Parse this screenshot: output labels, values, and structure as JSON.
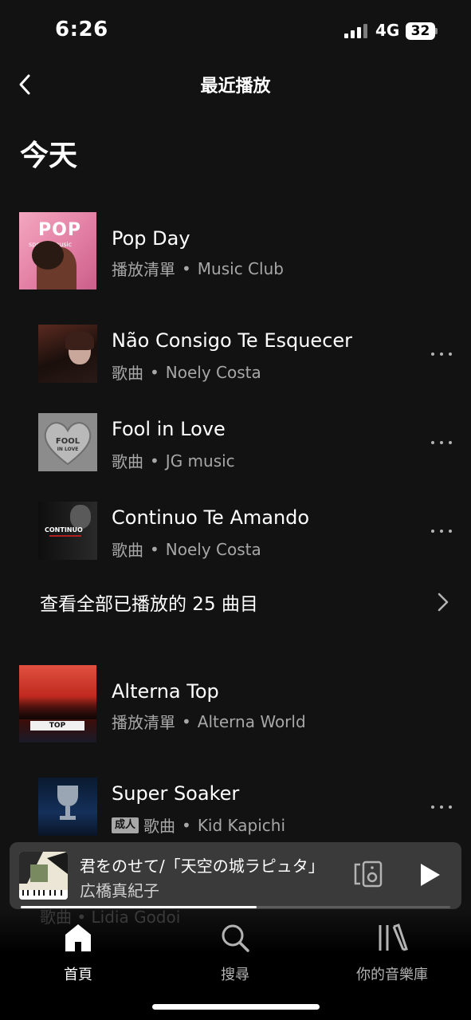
{
  "status": {
    "time": "6:26",
    "network": "4G",
    "battery": "32"
  },
  "header": {
    "title": "最近播放"
  },
  "section": {
    "title": "今天"
  },
  "items": [
    {
      "title": "Pop Day",
      "type": "播放清單",
      "owner": "Music Club",
      "art_text": "POP",
      "art_sub": "special music"
    },
    {
      "title": "Não Consigo Te Esquecer",
      "type": "歌曲",
      "owner": "Noely Costa"
    },
    {
      "title": "Fool in Love",
      "type": "歌曲",
      "owner": "JG music",
      "art_text": "FOOL",
      "art_sub": "IN LOVE"
    },
    {
      "title": "Continuo Te Amando",
      "type": "歌曲",
      "owner": "Noely Costa",
      "art_text": "CONTINUO"
    },
    {
      "title": "Alterna Top",
      "type": "播放清單",
      "owner": "Alterna World",
      "art_text": "TOP"
    },
    {
      "title": "Super Soaker",
      "type": "歌曲",
      "owner": "Kid Kapichi",
      "explicit": "成人"
    }
  ],
  "see_all": {
    "label": "查看全部已播放的 25 曲目"
  },
  "separator": "•",
  "mini_player": {
    "title": "君をのせて/「天空の城ラピュタ」",
    "artist": "広橋真紀子",
    "progress": 0.55
  },
  "behind_player": {
    "text": "歌曲 • Lidia Godoi"
  },
  "nav": [
    {
      "label": "首頁",
      "icon": "home-icon",
      "active": true
    },
    {
      "label": "搜尋",
      "icon": "search-icon",
      "active": false
    },
    {
      "label": "你的音樂庫",
      "icon": "library-icon",
      "active": false
    }
  ],
  "colors": {
    "background": "#121212",
    "subtext": "#a7a7a7",
    "player": "#3a3a3a"
  }
}
